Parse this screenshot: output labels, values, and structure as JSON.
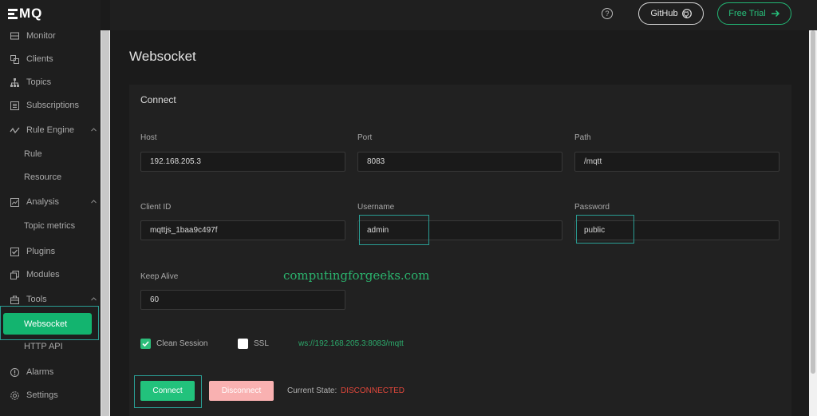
{
  "app": {
    "logo": "MQ"
  },
  "sidebar": {
    "items": [
      {
        "label": "Monitor",
        "icon": "monitor-icon"
      },
      {
        "label": "Clients",
        "icon": "clients-icon"
      },
      {
        "label": "Topics",
        "icon": "topics-icon"
      },
      {
        "label": "Subscriptions",
        "icon": "subscriptions-icon"
      },
      {
        "label": "Rule Engine",
        "icon": "rule-engine-icon",
        "sub": [
          "Rule",
          "Resource"
        ]
      },
      {
        "label": "Analysis",
        "icon": "analysis-icon",
        "sub": [
          "Topic metrics"
        ]
      },
      {
        "label": "Plugins",
        "icon": "plugins-icon"
      },
      {
        "label": "Modules",
        "icon": "modules-icon"
      },
      {
        "label": "Tools",
        "icon": "tools-icon",
        "sub": [
          "Websocket",
          "HTTP API"
        ]
      },
      {
        "label": "Alarms",
        "icon": "alarms-icon"
      },
      {
        "label": "Settings",
        "icon": "settings-icon"
      }
    ]
  },
  "header": {
    "help": "?",
    "github_label": "GitHub",
    "trial_label": "Free Trial"
  },
  "page": {
    "title": "Websocket"
  },
  "connect": {
    "title": "Connect",
    "host_label": "Host",
    "host_value": "192.168.205.3",
    "port_label": "Port",
    "port_value": "8083",
    "path_label": "Path",
    "path_value": "/mqtt",
    "client_id_label": "Client ID",
    "client_id_value": "mqttjs_1baa9c497f",
    "username_label": "Username",
    "username_value": "admin",
    "password_label": "Password",
    "password_value": "public",
    "keepalive_label": "Keep Alive",
    "keepalive_value": "60",
    "clean_session_label": "Clean Session",
    "clean_session_checked": true,
    "ssl_label": "SSL",
    "ssl_checked": false,
    "ws_url": "ws://192.168.205.3:8083/mqtt",
    "connect_label": "Connect",
    "disconnect_label": "Disconnect",
    "state_label": "Current State:",
    "state_value": "DISCONNECTED"
  },
  "watermark": "computingforgeeks.com",
  "colors": {
    "accent": "#22c27c",
    "highlight": "#2a9d93",
    "danger": "#e0473b"
  }
}
